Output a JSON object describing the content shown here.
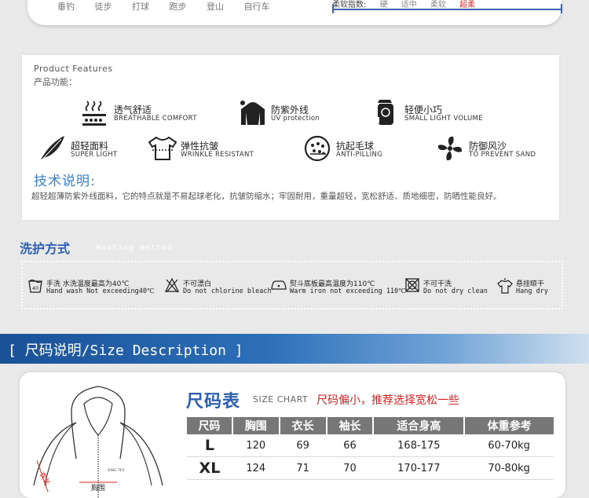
{
  "top_strip": {
    "activities": [
      "垂钓",
      "徒步",
      "打球",
      "跑步",
      "登山",
      "自行车"
    ],
    "scale_label": "柔软指数:",
    "scale": [
      "硬",
      "适中",
      "柔软",
      "超柔"
    ]
  },
  "features": {
    "heading_en": "Product Features",
    "heading_zh": "产品功能：",
    "items": [
      {
        "zh": "透气舒适",
        "en": "BREATHABLE COMFORT",
        "icon": "breathable-icon"
      },
      {
        "zh": "防紫外线",
        "en": "UV protection",
        "icon": "uv-jacket-icon"
      },
      {
        "zh": "轻便小巧",
        "en": "SMALL LIGHT VOLUME",
        "icon": "pouch-icon"
      },
      {
        "zh": "超轻面料",
        "en": "SUPER LIGHT",
        "icon": "feather-icon"
      },
      {
        "zh": "弹性抗皱",
        "en": "WRINKLE RESISTANT",
        "icon": "stretch-shirt-icon"
      },
      {
        "zh": "抗起毛球",
        "en": "ANTI-PILLING",
        "icon": "anti-pilling-icon"
      },
      {
        "zh": "防御风沙",
        "en": "TO PREVENT SAND",
        "icon": "fan-icon"
      }
    ],
    "tech_title": "技术说明:",
    "tech_text": "超轻超薄防紫外线面料，它的特点就是不易起球老化，抗皱防缩水；牢固耐用，重量超轻，宽松舒适、质地细密，防晒性能良好。"
  },
  "washing": {
    "title": "洗护方式",
    "subtitle": "Washing method",
    "items": [
      {
        "l1": "手洗  水洗温度最高为40℃",
        "l2": "Hand wash Not exceeding40℃",
        "icon": "hand-wash-icon",
        "badge": "40"
      },
      {
        "l1": "不可漂白",
        "l2": "Do not chlorine bleach",
        "icon": "no-bleach-icon"
      },
      {
        "l1": "熨斗底板最高温度为110℃",
        "l2": "Warm iron not exceeding 110℃",
        "icon": "iron-icon"
      },
      {
        "l1": "不可干洗",
        "l2": "Do not dry clean",
        "icon": "no-dry-clean-icon"
      },
      {
        "l1": "悬挂晾干",
        "l2": "Hang dry",
        "icon": "hang-dry-icon"
      }
    ]
  },
  "size": {
    "banner": "[ 尺码说明/Size Description ]",
    "title": "尺码表",
    "chart_label": "SIZE CHART",
    "note": "尺码偏小，推荐选择宽松一些",
    "jacket_labels": {
      "sleeve": "衣长",
      "chest": "胸围"
    },
    "headers": [
      "尺码",
      "胸围",
      "衣长",
      "袖长",
      "适合身高",
      "体重参考"
    ],
    "rows": [
      [
        "L",
        "120",
        "69",
        "66",
        "168-175",
        "60-70kg"
      ],
      [
        "XL",
        "124",
        "71",
        "70",
        "170-177",
        "70-80kg"
      ]
    ]
  },
  "colors": {
    "accent_blue": "#2f5fb3",
    "note_red": "#e02020",
    "header_gray": "#777777"
  }
}
